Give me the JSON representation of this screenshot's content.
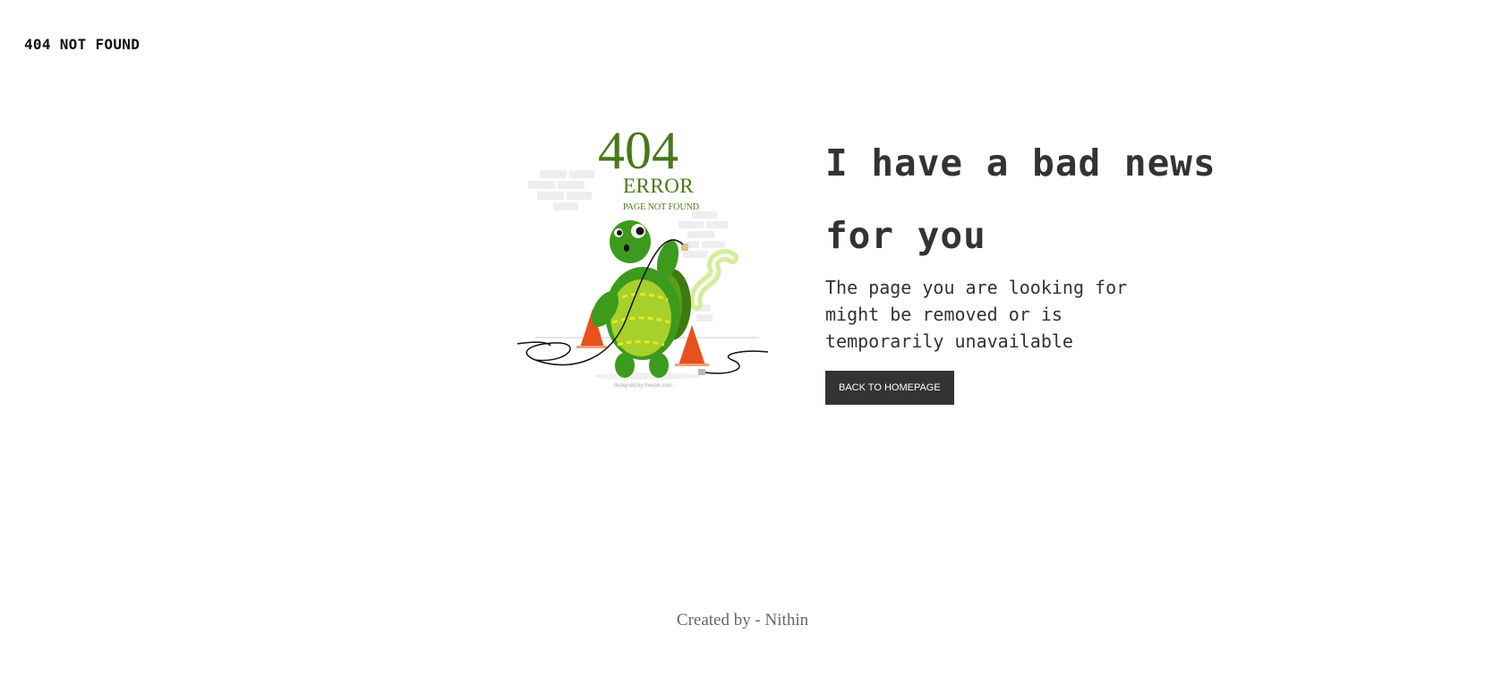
{
  "header": {
    "title": "404 NOT FOUND"
  },
  "illustration": {
    "code": "404",
    "error_label": "ERROR",
    "sub_label": "PAGE NOT FOUND",
    "credit": "designed by freepik.com",
    "colors": {
      "text_green": "#487818",
      "turtle_green": "#3c9a1c",
      "shell": "#9ccc2a",
      "cone": "#e8501c"
    }
  },
  "message": {
    "headline_line1": "I have a bad news",
    "headline_line2": "for you",
    "body": "The page you are looking for might be removed or is temporarily unavailable",
    "button_label": "BACK TO HOMEPAGE"
  },
  "footer": {
    "credit": "Created by - Nithin"
  },
  "colors": {
    "button_bg": "#333333",
    "text_dark": "#333333",
    "footer_text": "#666666"
  }
}
